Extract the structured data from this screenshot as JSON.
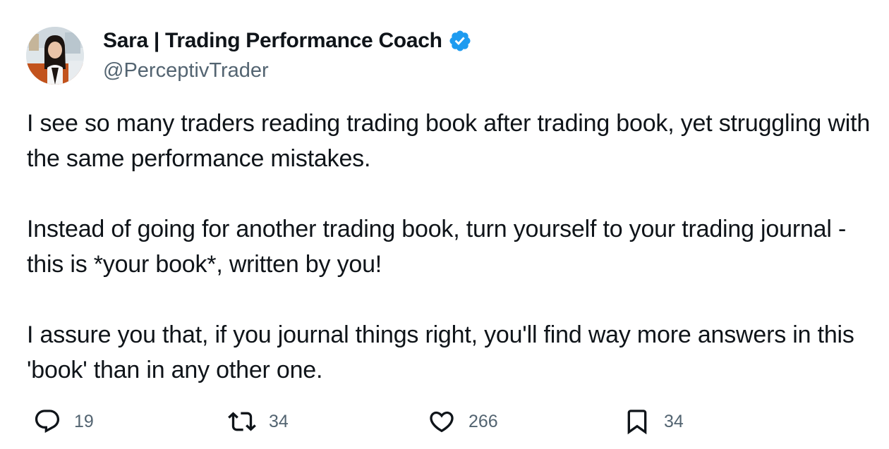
{
  "author": {
    "display_name": "Sara | Trading Performance Coach",
    "handle": "@PerceptivTrader",
    "verified": true,
    "avatar_icon": "profile-photo",
    "verified_icon": "verified-badge-icon",
    "verified_color": "#1d9bf0"
  },
  "tweet": {
    "paragraphs": [
      "I see so many traders reading trading book after trading book, yet struggling with the same performance mistakes.",
      "Instead of going for another trading book, turn yourself to your trading journal - this is *your book*, written by you!",
      "I assure you that, if you journal things right, you'll find way more answers in this 'book' than in any other one."
    ]
  },
  "actions": {
    "reply": {
      "icon": "reply-icon",
      "count": "19"
    },
    "retweet": {
      "icon": "retweet-icon",
      "count": "34"
    },
    "like": {
      "icon": "heart-icon",
      "count": "266"
    },
    "bookmark": {
      "icon": "bookmark-icon",
      "count": "34"
    }
  },
  "colors": {
    "text": "#0f1419",
    "secondary": "#536471",
    "accent": "#1d9bf0",
    "background": "#ffffff"
  }
}
